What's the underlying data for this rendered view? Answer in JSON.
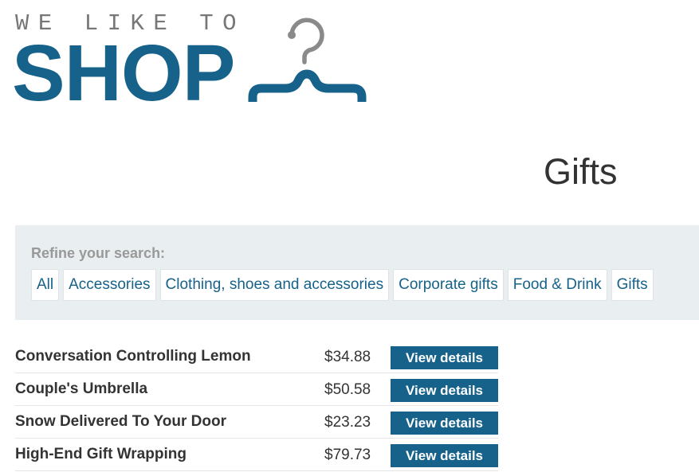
{
  "logo": {
    "tagline": "WE LIKE TO",
    "wordmark": "SHOP",
    "icon": "hanger-icon",
    "brand_color": "#16628a"
  },
  "page_title": "Gifts",
  "refine": {
    "label": "Refine your search:",
    "filters": [
      {
        "label": "All"
      },
      {
        "label": "Accessories"
      },
      {
        "label": "Clothing, shoes and accessories"
      },
      {
        "label": "Corporate gifts"
      },
      {
        "label": "Food & Drink"
      },
      {
        "label": "Gifts"
      }
    ]
  },
  "products": [
    {
      "name": "Conversation Controlling Lemon",
      "price": "$34.88",
      "button": "View details"
    },
    {
      "name": "Couple's Umbrella",
      "price": "$50.58",
      "button": "View details"
    },
    {
      "name": "Snow Delivered To Your Door",
      "price": "$23.23",
      "button": "View details"
    },
    {
      "name": "High-End Gift Wrapping",
      "price": "$79.73",
      "button": "View details"
    }
  ]
}
